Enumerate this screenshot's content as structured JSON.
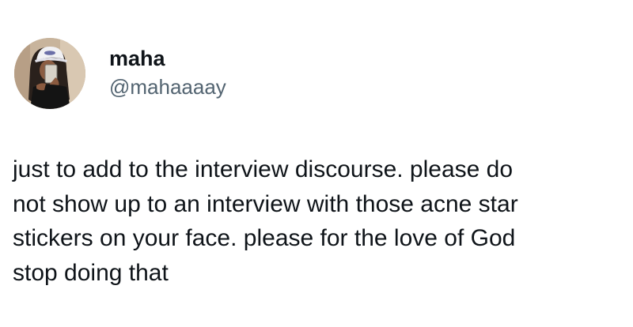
{
  "tweet": {
    "author": {
      "display_name": "maha",
      "handle": "@mahaaaay",
      "avatar_icon": "profile-photo"
    },
    "text_lines": [
      "just to add to the interview discourse. please do",
      "not show up to an interview with those acne star",
      "stickers on your face. please for the love of God",
      "stop doing that"
    ]
  },
  "colors": {
    "text_primary": "#0f1419",
    "text_secondary": "#536471",
    "background": "#ffffff"
  }
}
